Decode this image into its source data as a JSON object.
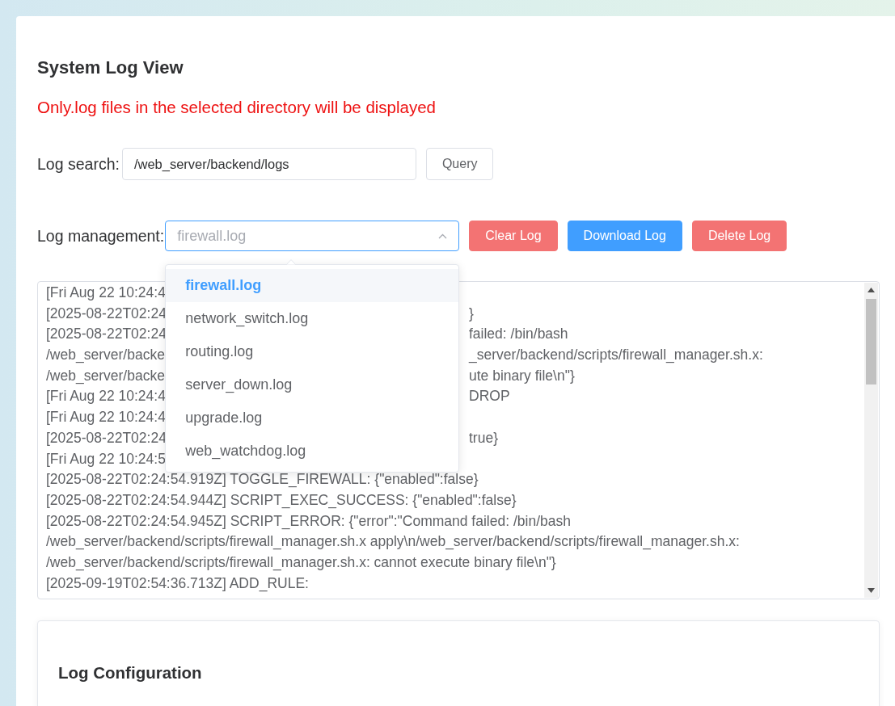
{
  "page": {
    "title": "System Log View",
    "notice": "Only.log files in the selected directory will be displayed"
  },
  "search": {
    "label": "Log search:",
    "value": "/web_server/backend/logs",
    "button": "Query"
  },
  "management": {
    "label": "Log management:",
    "select": {
      "value": "firewall.log",
      "expanded": true
    },
    "buttons": [
      {
        "label": "Clear Log",
        "kind": "danger"
      },
      {
        "label": "Download Log",
        "kind": "primary"
      },
      {
        "label": "Delete Log",
        "kind": "danger"
      }
    ],
    "options": [
      {
        "label": "firewall.log",
        "selected": true
      },
      {
        "label": "network_switch.log",
        "selected": false
      },
      {
        "label": "routing.log",
        "selected": false
      },
      {
        "label": "server_down.log",
        "selected": false
      },
      {
        "label": "upgrade.log",
        "selected": false
      },
      {
        "label": "web_watchdog.log",
        "selected": false
      }
    ]
  },
  "log_lines": [
    {
      "left": "[Fri Aug 22 10:24:4"
    },
    {
      "left": "[2025-08-22T02:24",
      "right": "}"
    },
    {
      "left": "[2025-08-22T02:24",
      "right": " failed: /bin/bash"
    },
    {
      "left": "/web_server/backe",
      "right": "_server/backend/scripts/firewall_manager.sh.x:"
    },
    {
      "left": "/web_server/backe",
      "right": "ute binary file\\n\"}"
    },
    {
      "left": "[Fri Aug 22 10:24:4",
      "right": " DROP"
    },
    {
      "left": "[Fri Aug 22 10:24:4"
    },
    {
      "left": "[2025-08-22T02:24",
      "right": "true}"
    },
    {
      "left": "[Fri Aug 22 10:24:5"
    },
    {
      "left": "[2025-08-22T02:24:54.919Z] TOGGLE_FIREWALL: {\"enabled\":false}"
    },
    {
      "left": "[2025-08-22T02:24:54.944Z] SCRIPT_EXEC_SUCCESS: {\"enabled\":false}"
    },
    {
      "left": "[2025-08-22T02:24:54.945Z] SCRIPT_ERROR: {\"error\":\"Command failed: /bin/bash"
    },
    {
      "left": "/web_server/backend/scripts/firewall_manager.sh.x apply\\n/web_server/backend/scripts/firewall_manager.sh.x:"
    },
    {
      "left": "/web_server/backend/scripts/firewall_manager.sh.x: cannot execute binary file\\n\"}"
    },
    {
      "left": "[2025-09-19T02:54:36.713Z] ADD_RULE:"
    }
  ],
  "config": {
    "title": "Log Configuration"
  }
}
